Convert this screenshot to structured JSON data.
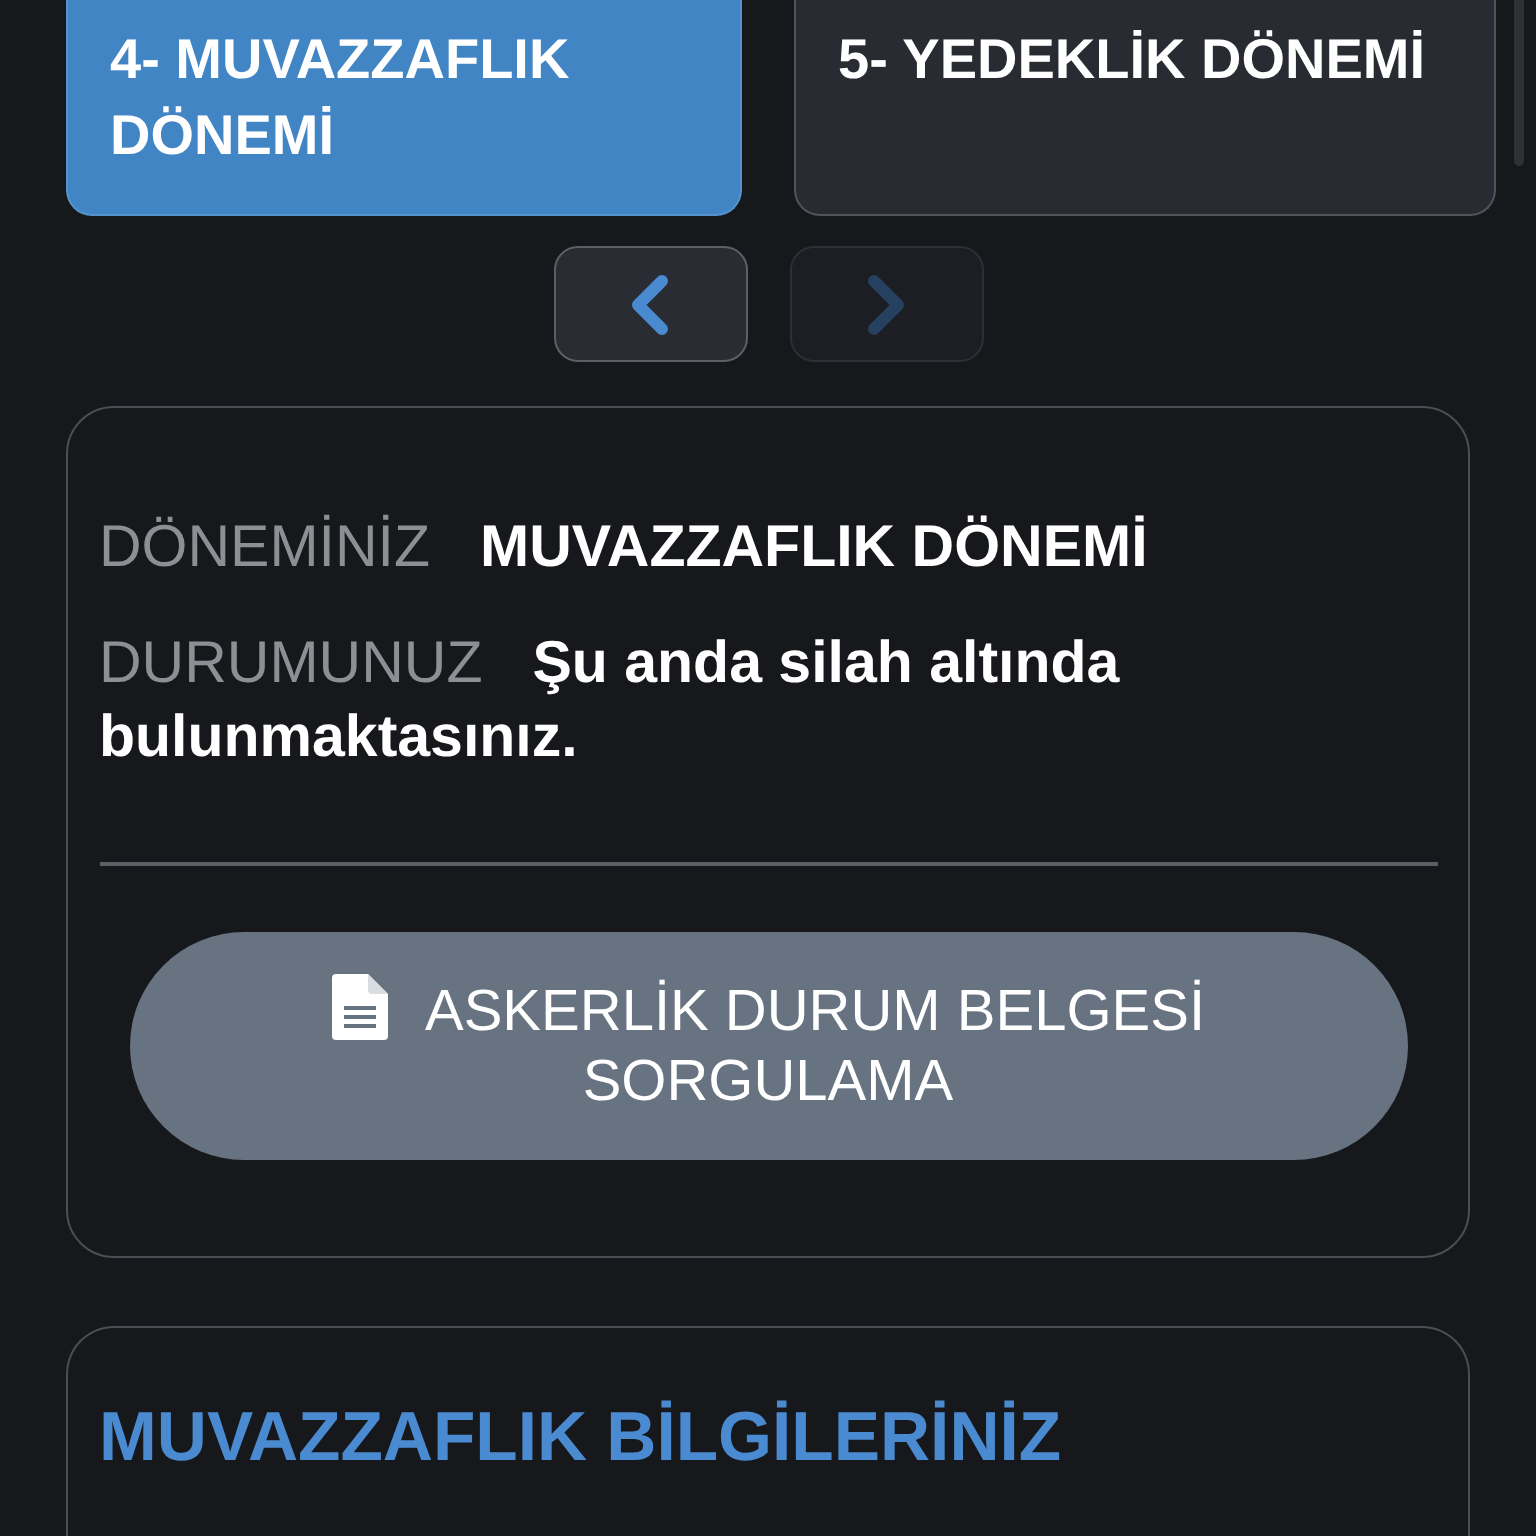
{
  "tabs": [
    {
      "label": "4- MUVAZZAFLIK DÖNEMİ",
      "selected": true
    },
    {
      "label": "5- YEDEKLİK DÖNEMİ",
      "selected": false
    }
  ],
  "pager": [
    {
      "kind": "prev",
      "disabled": false
    },
    {
      "kind": "next",
      "disabled": true
    }
  ],
  "status_card": {
    "rows": [
      {
        "label": "DÖNEMİNİZ",
        "value": "MUVAZZAFLIK DÖNEMİ"
      },
      {
        "label": "DURUMUNUZ",
        "value": "Şu anda silah altında bulunmaktasınız."
      }
    ],
    "button": {
      "label": "ASKERLİK DURUM BELGESİ SORGULAMA"
    }
  },
  "info_card": {
    "title": "MUVAZZAFLIK BİLGİLERİNİZ"
  }
}
